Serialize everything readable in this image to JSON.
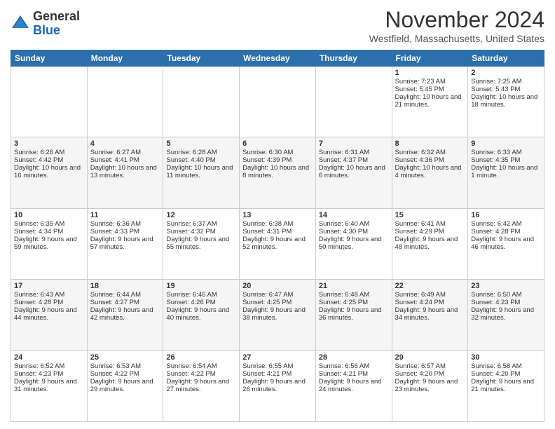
{
  "header": {
    "logo_general": "General",
    "logo_blue": "Blue",
    "month_title": "November 2024",
    "location": "Westfield, Massachusetts, United States"
  },
  "weekdays": [
    "Sunday",
    "Monday",
    "Tuesday",
    "Wednesday",
    "Thursday",
    "Friday",
    "Saturday"
  ],
  "weeks": [
    [
      {
        "day": "",
        "info": ""
      },
      {
        "day": "",
        "info": ""
      },
      {
        "day": "",
        "info": ""
      },
      {
        "day": "",
        "info": ""
      },
      {
        "day": "",
        "info": ""
      },
      {
        "day": "1",
        "info": "Sunrise: 7:23 AM\nSunset: 5:45 PM\nDaylight: 10 hours and 21 minutes."
      },
      {
        "day": "2",
        "info": "Sunrise: 7:25 AM\nSunset: 5:43 PM\nDaylight: 10 hours and 18 minutes."
      }
    ],
    [
      {
        "day": "3",
        "info": "Sunrise: 6:26 AM\nSunset: 4:42 PM\nDaylight: 10 hours and 16 minutes."
      },
      {
        "day": "4",
        "info": "Sunrise: 6:27 AM\nSunset: 4:41 PM\nDaylight: 10 hours and 13 minutes."
      },
      {
        "day": "5",
        "info": "Sunrise: 6:28 AM\nSunset: 4:40 PM\nDaylight: 10 hours and 11 minutes."
      },
      {
        "day": "6",
        "info": "Sunrise: 6:30 AM\nSunset: 4:39 PM\nDaylight: 10 hours and 8 minutes."
      },
      {
        "day": "7",
        "info": "Sunrise: 6:31 AM\nSunset: 4:37 PM\nDaylight: 10 hours and 6 minutes."
      },
      {
        "day": "8",
        "info": "Sunrise: 6:32 AM\nSunset: 4:36 PM\nDaylight: 10 hours and 4 minutes."
      },
      {
        "day": "9",
        "info": "Sunrise: 6:33 AM\nSunset: 4:35 PM\nDaylight: 10 hours and 1 minute."
      }
    ],
    [
      {
        "day": "10",
        "info": "Sunrise: 6:35 AM\nSunset: 4:34 PM\nDaylight: 9 hours and 59 minutes."
      },
      {
        "day": "11",
        "info": "Sunrise: 6:36 AM\nSunset: 4:33 PM\nDaylight: 9 hours and 57 minutes."
      },
      {
        "day": "12",
        "info": "Sunrise: 6:37 AM\nSunset: 4:32 PM\nDaylight: 9 hours and 55 minutes."
      },
      {
        "day": "13",
        "info": "Sunrise: 6:38 AM\nSunset: 4:31 PM\nDaylight: 9 hours and 52 minutes."
      },
      {
        "day": "14",
        "info": "Sunrise: 6:40 AM\nSunset: 4:30 PM\nDaylight: 9 hours and 50 minutes."
      },
      {
        "day": "15",
        "info": "Sunrise: 6:41 AM\nSunset: 4:29 PM\nDaylight: 9 hours and 48 minutes."
      },
      {
        "day": "16",
        "info": "Sunrise: 6:42 AM\nSunset: 4:28 PM\nDaylight: 9 hours and 46 minutes."
      }
    ],
    [
      {
        "day": "17",
        "info": "Sunrise: 6:43 AM\nSunset: 4:28 PM\nDaylight: 9 hours and 44 minutes."
      },
      {
        "day": "18",
        "info": "Sunrise: 6:44 AM\nSunset: 4:27 PM\nDaylight: 9 hours and 42 minutes."
      },
      {
        "day": "19",
        "info": "Sunrise: 6:46 AM\nSunset: 4:26 PM\nDaylight: 9 hours and 40 minutes."
      },
      {
        "day": "20",
        "info": "Sunrise: 6:47 AM\nSunset: 4:25 PM\nDaylight: 9 hours and 38 minutes."
      },
      {
        "day": "21",
        "info": "Sunrise: 6:48 AM\nSunset: 4:25 PM\nDaylight: 9 hours and 36 minutes."
      },
      {
        "day": "22",
        "info": "Sunrise: 6:49 AM\nSunset: 4:24 PM\nDaylight: 9 hours and 34 minutes."
      },
      {
        "day": "23",
        "info": "Sunrise: 6:50 AM\nSunset: 4:23 PM\nDaylight: 9 hours and 32 minutes."
      }
    ],
    [
      {
        "day": "24",
        "info": "Sunrise: 6:52 AM\nSunset: 4:23 PM\nDaylight: 9 hours and 31 minutes."
      },
      {
        "day": "25",
        "info": "Sunrise: 6:53 AM\nSunset: 4:22 PM\nDaylight: 9 hours and 29 minutes."
      },
      {
        "day": "26",
        "info": "Sunrise: 6:54 AM\nSunset: 4:22 PM\nDaylight: 9 hours and 27 minutes."
      },
      {
        "day": "27",
        "info": "Sunrise: 6:55 AM\nSunset: 4:21 PM\nDaylight: 9 hours and 26 minutes."
      },
      {
        "day": "28",
        "info": "Sunrise: 6:56 AM\nSunset: 4:21 PM\nDaylight: 9 hours and 24 minutes."
      },
      {
        "day": "29",
        "info": "Sunrise: 6:57 AM\nSunset: 4:20 PM\nDaylight: 9 hours and 23 minutes."
      },
      {
        "day": "30",
        "info": "Sunrise: 6:58 AM\nSunset: 4:20 PM\nDaylight: 9 hours and 21 minutes."
      }
    ]
  ]
}
